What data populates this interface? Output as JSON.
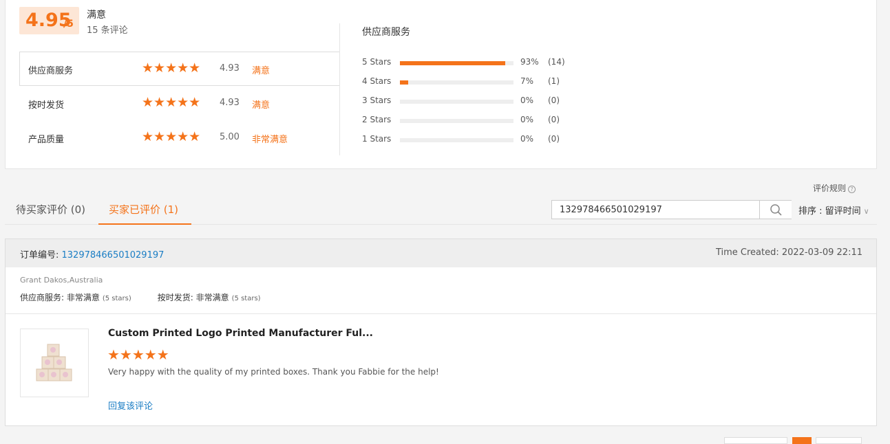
{
  "summary": {
    "score": "4.95",
    "score_max": "/5",
    "overall_label": "满意",
    "review_count": "15 条评论",
    "ratings": [
      {
        "label": "供应商服务",
        "stars": "★★★★★",
        "value": "4.93",
        "text": "满意"
      },
      {
        "label": "按时发货",
        "stars": "★★★★★",
        "value": "4.93",
        "text": "满意"
      },
      {
        "label": "产品质量",
        "stars": "★★★★★",
        "value": "5.00",
        "text": "非常满意"
      }
    ],
    "service_title": "供应商服务",
    "breakdown": [
      {
        "label": "5 Stars",
        "fraction": 0.93,
        "pct": "93%",
        "count": "(14)"
      },
      {
        "label": "4 Stars",
        "fraction": 0.07,
        "pct": "7%",
        "count": "(1)"
      },
      {
        "label": "3 Stars",
        "fraction": 0,
        "pct": "0%",
        "count": "(0)"
      },
      {
        "label": "2 Stars",
        "fraction": 0,
        "pct": "0%",
        "count": "(0)"
      },
      {
        "label": "1 Stars",
        "fraction": 0,
        "pct": "0%",
        "count": "(0)"
      }
    ]
  },
  "toolbar": {
    "rules_label": "评价规则",
    "help_icon": "?",
    "tab_pending": "待买家评价 (0)",
    "tab_reviewed": "买家已评价 (1)",
    "search_value": "132978466501029197",
    "sort_label": "排序 : 留评时间",
    "sort_chevron": "∨"
  },
  "review": {
    "order_label": "订单编号: ",
    "order_number": "132978466501029197",
    "time_created": "Time Created: 2022-03-09 22:11",
    "buyer": "Grant Dakos,Australia",
    "service_label": "供应商服务: 非常满意",
    "service_stars": "(5 stars)",
    "shipping_label": "按时发货: 非常满意",
    "shipping_stars": "(5 stars)",
    "product_title": "Custom Printed Logo Printed Manufacturer Ful...",
    "product_stars": "★★★★★",
    "comment": "Very happy with the quality of my printed boxes. Thank you Fabbie for the help!",
    "reply_label": "回复该评论"
  },
  "colors": {
    "accent": "#f4731a",
    "link": "#1a7dc4"
  }
}
